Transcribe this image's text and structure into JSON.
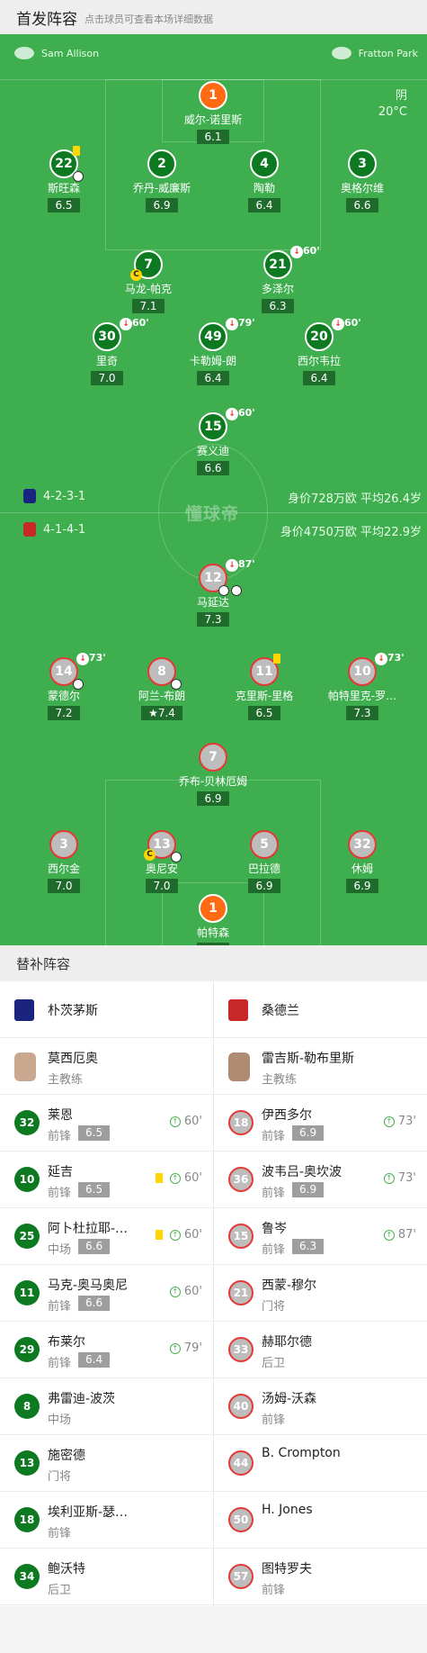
{
  "header": {
    "title": "首发阵容",
    "subtitle": "点击球员可查看本场详细数据"
  },
  "pitch": {
    "home_referee": "Sam Allison",
    "venue": "Fratton Park",
    "weather": "阴",
    "temperature": "20°C",
    "watermark": "懂球帝",
    "home_formation": "4-2-3-1",
    "home_value": "身价728万欧   平均26.4岁",
    "away_formation": "4-1-4-1",
    "away_value": "身价4750万欧  平均22.9岁",
    "home_players": [
      {
        "num": "1",
        "name": "威尔-诺里斯",
        "rating": "6.1",
        "gk": true
      },
      {
        "num": "22",
        "name": "斯旺森",
        "rating": "6.5"
      },
      {
        "num": "2",
        "name": "乔丹-威廉斯",
        "rating": "6.9"
      },
      {
        "num": "4",
        "name": "陶勒",
        "rating": "6.4"
      },
      {
        "num": "3",
        "name": "奥格尔维",
        "rating": "6.6"
      },
      {
        "num": "7",
        "name": "马龙-帕克",
        "rating": "7.1"
      },
      {
        "num": "21",
        "name": "多泽尔",
        "rating": "6.3",
        "sub": "60'"
      },
      {
        "num": "30",
        "name": "里奇",
        "rating": "7.0",
        "sub": "60'"
      },
      {
        "num": "49",
        "name": "卡勒姆-朗",
        "rating": "6.4",
        "sub": "79'"
      },
      {
        "num": "20",
        "name": "西尔韦拉",
        "rating": "6.4",
        "sub": "60'"
      },
      {
        "num": "15",
        "name": "赛义迪",
        "rating": "6.6",
        "sub": "60'"
      }
    ],
    "away_players": [
      {
        "num": "12",
        "name": "马延达",
        "rating": "7.3",
        "sub": "87'"
      },
      {
        "num": "14",
        "name": "蒙德尔",
        "rating": "7.2",
        "sub": "73'"
      },
      {
        "num": "8",
        "name": "阿兰-布朗",
        "rating": "7.4"
      },
      {
        "num": "11",
        "name": "克里斯-里格",
        "rating": "6.5"
      },
      {
        "num": "10",
        "name": "帕特里克-罗…",
        "rating": "7.3",
        "sub": "73'"
      },
      {
        "num": "7",
        "name": "乔布-贝林厄姆",
        "rating": "6.9"
      },
      {
        "num": "3",
        "name": "西尔金",
        "rating": "7.0"
      },
      {
        "num": "13",
        "name": "奥尼安",
        "rating": "7.0"
      },
      {
        "num": "5",
        "name": "巴拉德",
        "rating": "6.9"
      },
      {
        "num": "32",
        "name": "休姆",
        "rating": "6.9"
      },
      {
        "num": "1",
        "name": "帕特森",
        "rating": "6.4",
        "gk": true
      }
    ]
  },
  "bench": {
    "title": "替补阵容",
    "home_team": "朴茨茅斯",
    "away_team": "桑德兰",
    "home_coach": {
      "name": "莫西厄奥",
      "role": "主教练"
    },
    "away_coach": {
      "name": "雷吉斯-勒布里斯",
      "role": "主教练"
    },
    "home_subs": [
      {
        "num": "32",
        "name": "莱恩",
        "pos": "前锋",
        "rating": "6.5",
        "time": "60'"
      },
      {
        "num": "10",
        "name": "延吉",
        "pos": "前锋",
        "rating": "6.5",
        "time": "60'",
        "yellow": true
      },
      {
        "num": "25",
        "name": "阿卜杜拉耶-…",
        "pos": "中场",
        "rating": "6.6",
        "time": "60'",
        "yellow": true
      },
      {
        "num": "11",
        "name": "马克-奥马奥尼",
        "pos": "前锋",
        "rating": "6.6",
        "time": "60'"
      },
      {
        "num": "29",
        "name": "布莱尔",
        "pos": "前锋",
        "rating": "6.4",
        "time": "79'"
      },
      {
        "num": "8",
        "name": "弗雷迪-波茨",
        "pos": "中场"
      },
      {
        "num": "13",
        "name": "施密德",
        "pos": "门将"
      },
      {
        "num": "18",
        "name": "埃利亚斯-瑟…",
        "pos": "前锋"
      },
      {
        "num": "34",
        "name": "鲍沃特",
        "pos": "后卫"
      }
    ],
    "away_subs": [
      {
        "num": "18",
        "name": "伊西多尔",
        "pos": "前锋",
        "rating": "6.9",
        "time": "73'"
      },
      {
        "num": "36",
        "name": "波韦吕-奥坎波",
        "pos": "前锋",
        "rating": "6.9",
        "time": "73'"
      },
      {
        "num": "15",
        "name": "鲁岑",
        "pos": "前锋",
        "rating": "6.3",
        "time": "87'"
      },
      {
        "num": "21",
        "name": "西蒙-穆尔",
        "pos": "门将"
      },
      {
        "num": "33",
        "name": "赫耶尔德",
        "pos": "后卫"
      },
      {
        "num": "40",
        "name": "汤姆-沃森",
        "pos": "前锋"
      },
      {
        "num": "44",
        "name": "B. Crompton",
        "pos": ""
      },
      {
        "num": "50",
        "name": "H. Jones",
        "pos": ""
      },
      {
        "num": "57",
        "name": "图特罗夫",
        "pos": "前锋"
      }
    ]
  },
  "colors": {
    "pitch": "#3fae4f",
    "home": "#0d7a22",
    "gk": "#ff6a13",
    "away_ring": "#e53935"
  }
}
